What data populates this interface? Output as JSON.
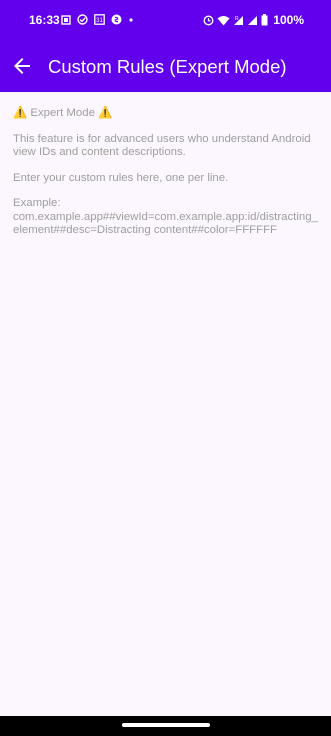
{
  "status_bar": {
    "time": "16:33",
    "battery": "100%",
    "left_icons": [
      "screenshot-icon",
      "check-circle-icon",
      "calendar-31-icon",
      "shazam-icon",
      "dot-icon"
    ],
    "right_icons": [
      "alarm-icon",
      "wifi-icon",
      "signal-r-icon",
      "signal-icon",
      "battery-icon"
    ]
  },
  "app_bar": {
    "title": "Custom Rules (Expert Mode)",
    "background": "#6200ee"
  },
  "content": {
    "heading": "⚠️ Expert Mode ⚠️",
    "para1": "This feature is for advanced users who understand Android view IDs and content descriptions.",
    "para2": "Enter your custom rules here, one per line.",
    "example_label": "Example:",
    "example_text": "com.example.app##viewId=com.example.app:id/distracting_element##desc=Distracting content##color=FFFFFF"
  }
}
